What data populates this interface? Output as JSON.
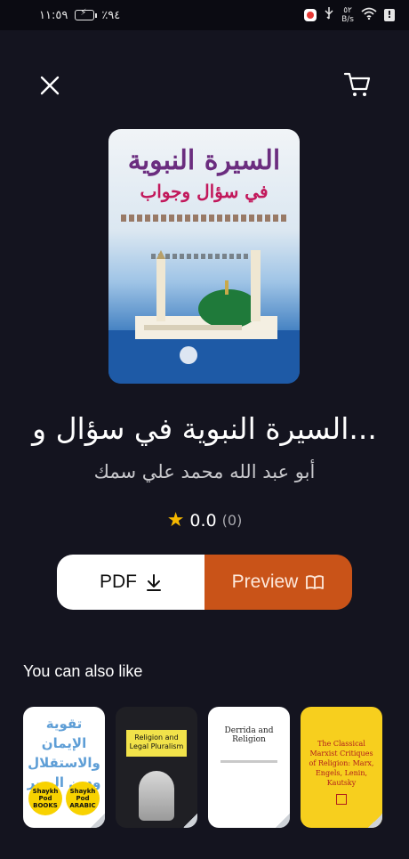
{
  "status_bar": {
    "time": "١١:٥٩",
    "battery": "٪٩٤",
    "speed_value": "٥٢",
    "speed_unit": "B/s"
  },
  "icons": {
    "close": "close-icon",
    "cart": "cart-icon",
    "download": "download-icon",
    "book": "book-open-icon",
    "star": "star-icon"
  },
  "book": {
    "cover_title": "السيرة النبوية",
    "cover_subtitle": "في سؤال وجواب",
    "title": "...السيرة النبوية في سؤال و",
    "author": "أبو عبد الله محمد علي سمك",
    "rating": "0.0",
    "rating_count": "(0)"
  },
  "actions": {
    "pdf_label": "PDF",
    "preview_label": "Preview"
  },
  "recommendations": {
    "section_title": "You can also like",
    "items": [
      {
        "text": "تقوية الإيمان والاستقلال ودين اليسر",
        "badge_1": "Shaykh Pod BOOKS",
        "badge_2": "Shaykh Pod ARABIC"
      },
      {
        "text": "Religion and Legal Pluralism"
      },
      {
        "text": "Derrida and Religion"
      },
      {
        "text": "The Classical Marxist Critiques of Religion: Marx, Engels, Lenin, Kautsky"
      }
    ]
  },
  "colors": {
    "background": "#14141f",
    "preview_button": "#c95318",
    "star": "#f5b800"
  }
}
